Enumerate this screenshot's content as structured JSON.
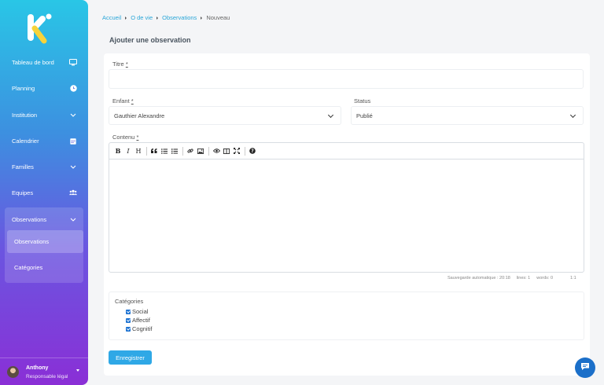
{
  "sidebar": {
    "items": [
      {
        "label": "Tableau de bord",
        "icon": "monitor-icon"
      },
      {
        "label": "Planning",
        "icon": "clock-icon"
      },
      {
        "label": "Institution",
        "icon": "chevron-down-icon"
      },
      {
        "label": "Calendrier",
        "icon": "calendar-icon"
      },
      {
        "label": "Familles",
        "icon": "chevron-down-icon"
      },
      {
        "label": "Equipes",
        "icon": "users-icon"
      },
      {
        "label": "Observations",
        "icon": "chevron-down-icon"
      }
    ],
    "sub_items": [
      {
        "label": "Observations",
        "active": true
      },
      {
        "label": "Catégories",
        "active": false
      }
    ],
    "user": {
      "name": "Anthony",
      "role": "Responsable légal"
    }
  },
  "breadcrumb": {
    "items": [
      "Accueil",
      "O de vie",
      "Observations"
    ],
    "current": "Nouveau"
  },
  "page_title": "Ajouter une observation",
  "form": {
    "title_label": "Titre",
    "title_required": "*",
    "title_value": "",
    "child_label": "Enfant",
    "child_required": "*",
    "child_value": "Gauthier Alexandre",
    "status_label": "Status",
    "status_value": "Publié",
    "content_label": "Contenu",
    "content_required": "*",
    "editor_status": {
      "autosave": "Sauvegarde automatique : 20:18",
      "lines": "lines: 1",
      "words": "words: 0",
      "cursor": "1:1"
    },
    "categories_label": "Catégories",
    "categories": [
      {
        "label": "Social",
        "checked": true
      },
      {
        "label": "Affectif",
        "checked": true
      },
      {
        "label": "Cognitif",
        "checked": true
      }
    ],
    "save_label": "Enregistrer"
  },
  "colors": {
    "accent": "#2fa8e6",
    "link": "#2aa6d8",
    "chat": "#1b6fc9"
  }
}
